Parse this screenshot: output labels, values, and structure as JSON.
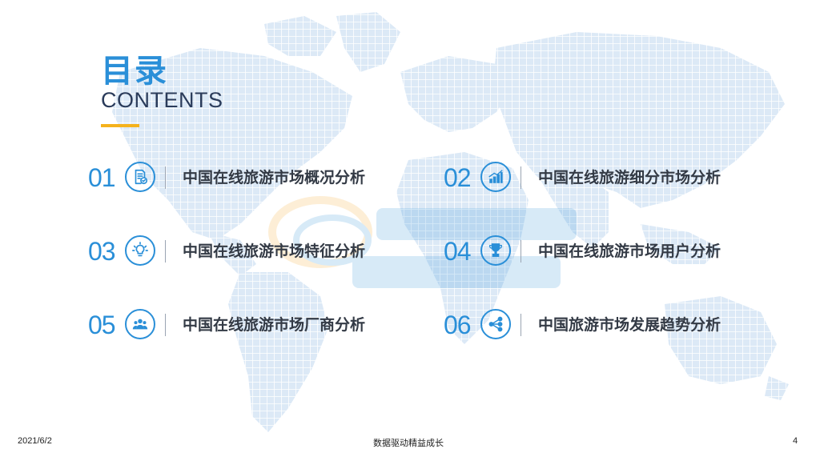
{
  "title": {
    "cn": "目录",
    "en": "CONTENTS"
  },
  "colors": {
    "accent_blue": "#2a8fd8",
    "accent_yellow": "#f5b21c",
    "map_grid": "#dfeaf6",
    "text_dark": "#333a45"
  },
  "items": [
    {
      "num": "01",
      "label": "中国在线旅游市场概况分析",
      "icon": "document-check-icon"
    },
    {
      "num": "02",
      "label": "中国在线旅游细分市场分析",
      "icon": "bar-chart-icon"
    },
    {
      "num": "03",
      "label": "中国在线旅游市场特征分析",
      "icon": "lightbulb-icon"
    },
    {
      "num": "04",
      "label": "中国在线旅游市场用户分析",
      "icon": "trophy-icon"
    },
    {
      "num": "05",
      "label": "中国在线旅游市场厂商分析",
      "icon": "user-group-icon"
    },
    {
      "num": "06",
      "label": "中国旅游市场发展趋势分析",
      "icon": "share-network-icon"
    }
  ],
  "footer": {
    "date": "2021/6/2",
    "slogan": "数据驱动精益成长",
    "page": "4"
  }
}
